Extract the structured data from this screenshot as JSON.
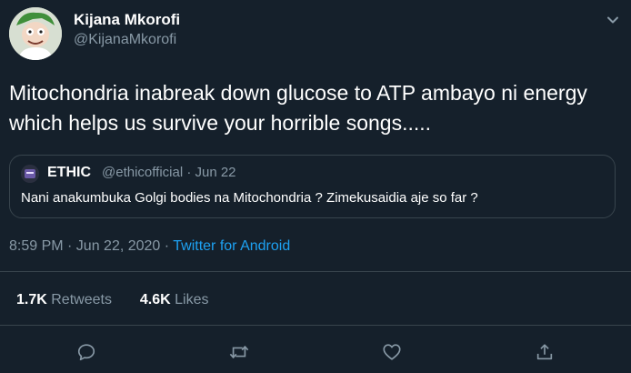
{
  "author": {
    "name": "Kijana Mkorofi",
    "handle": "@KijanaMkorofi"
  },
  "tweet": {
    "text": "Mitochondria inabreak down glucose to ATP ambayo ni energy which helps us survive your horrible songs....."
  },
  "quoted": {
    "name": "ETHIC",
    "handle_date": "@ethicofficial · Jun 22",
    "text": "Nani anakumbuka Golgi bodies na Mitochondria ? Zimekusaidia aje so far ?"
  },
  "meta": {
    "time_date": "8:59 PM · Jun 22, 2020 · ",
    "app": "Twitter for Android"
  },
  "stats": {
    "retweets_count": "1.7K",
    "retweets_label": "Retweets",
    "likes_count": "4.6K",
    "likes_label": "Likes"
  },
  "icons": {
    "more": "chevron-down-icon",
    "reply": "reply-icon",
    "retweet": "retweet-icon",
    "like": "heart-icon",
    "share": "share-icon"
  },
  "colors": {
    "background": "#15202b",
    "secondary_text": "#8899a6",
    "link": "#1da1f2",
    "border": "#38444d"
  }
}
